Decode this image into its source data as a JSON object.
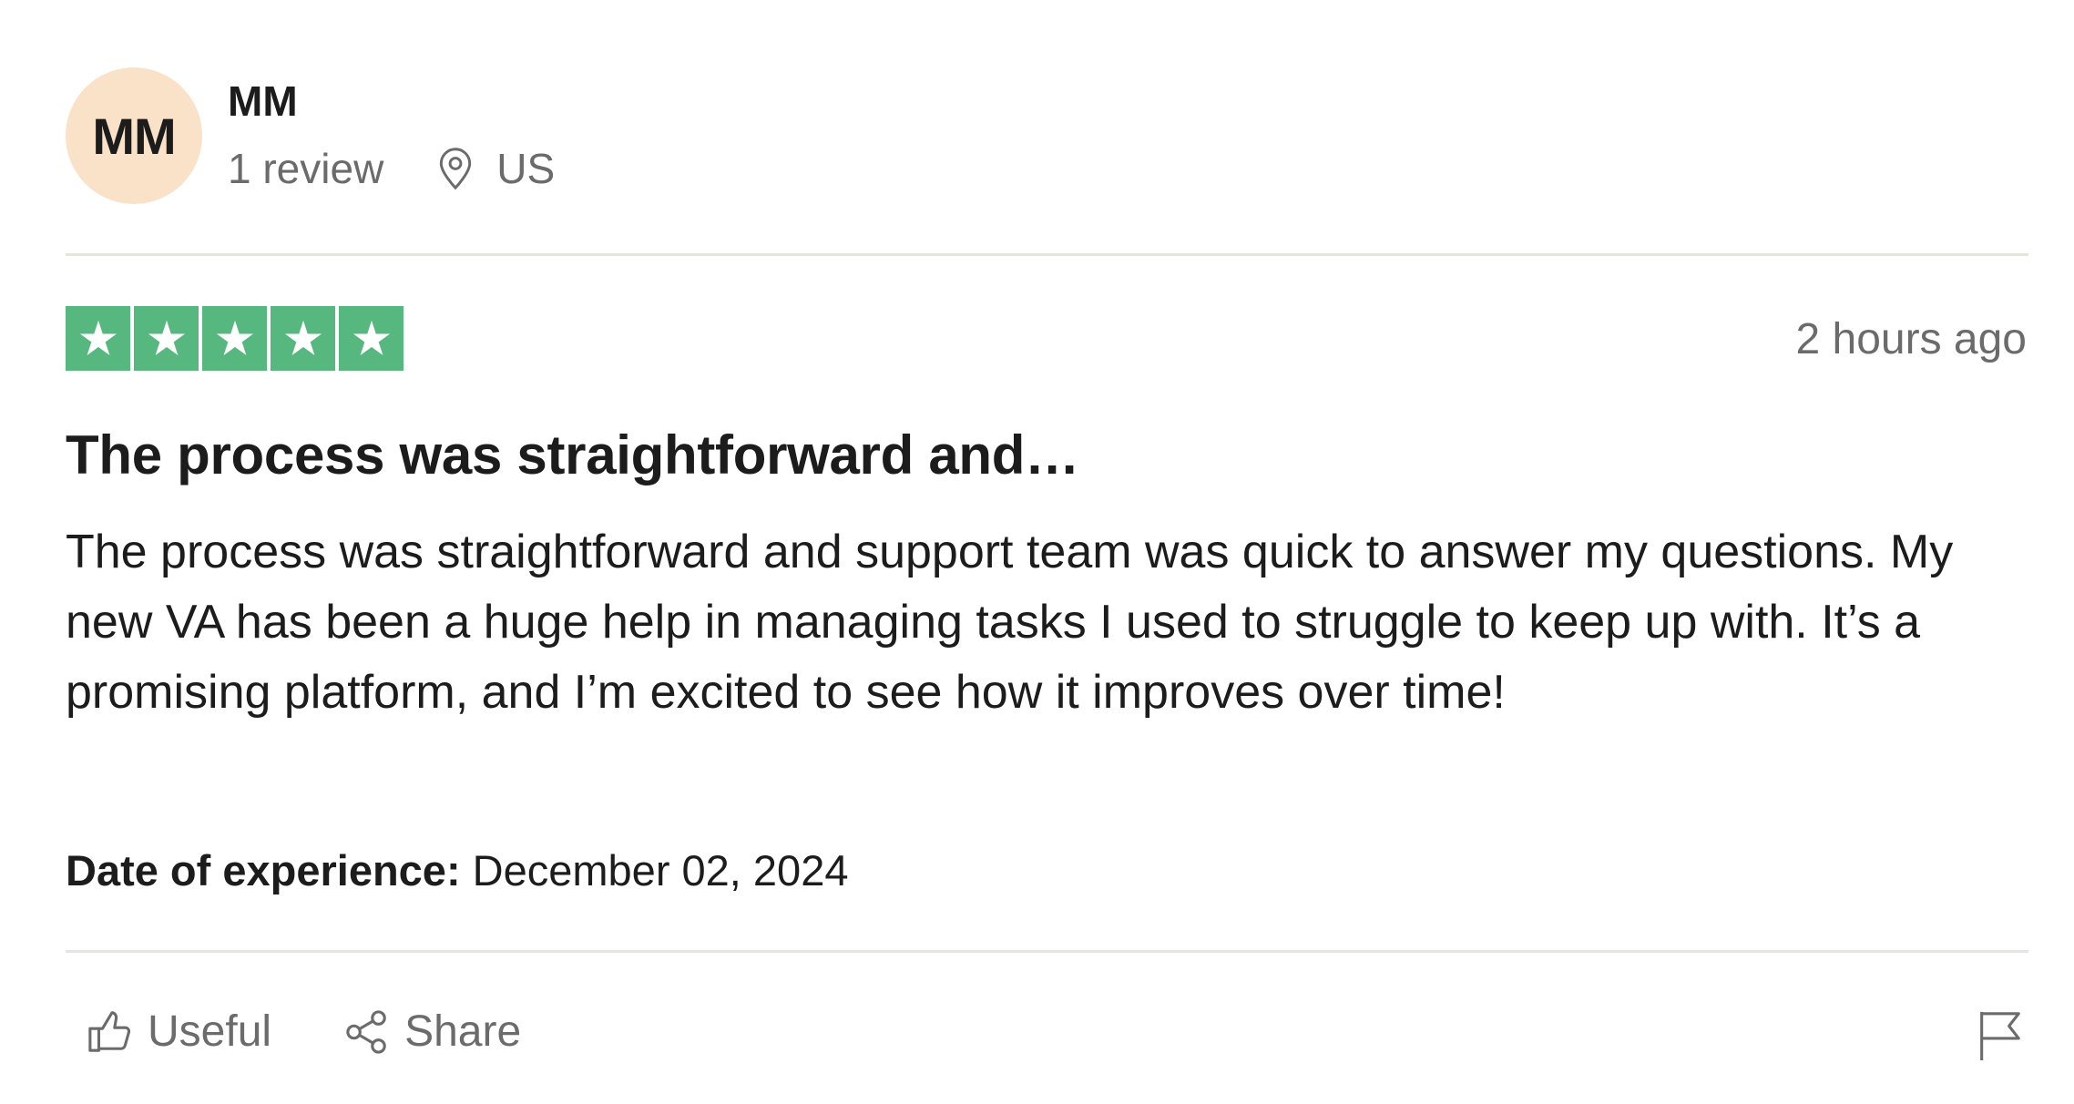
{
  "reviewer": {
    "initials": "MM",
    "name": "MM",
    "review_count": "1 review",
    "location": "US"
  },
  "review": {
    "rating": 5,
    "rating_max": 5,
    "posted": "2 hours ago",
    "title": "The process was straightforward and…",
    "body": "The process was straightforward and support team was quick to answer my questions. My new VA has been a huge help in managing tasks I used to struggle to keep up with. It’s a promising platform, and I’m excited to see how it improves over time!",
    "experience_label": "Date of experience:",
    "experience_date": " December 02, 2024"
  },
  "actions": {
    "useful_label": "Useful",
    "share_label": "Share"
  },
  "icons": {
    "location": "location-pin-icon",
    "useful": "thumbs-up-icon",
    "share": "share-icon",
    "report": "flag-icon",
    "star": "star-icon"
  },
  "colors": {
    "star_fill": "#57b87f",
    "avatar_bg": "#f9e2c8",
    "muted_text": "#6b6b6b",
    "divider": "#e5e5dd"
  }
}
